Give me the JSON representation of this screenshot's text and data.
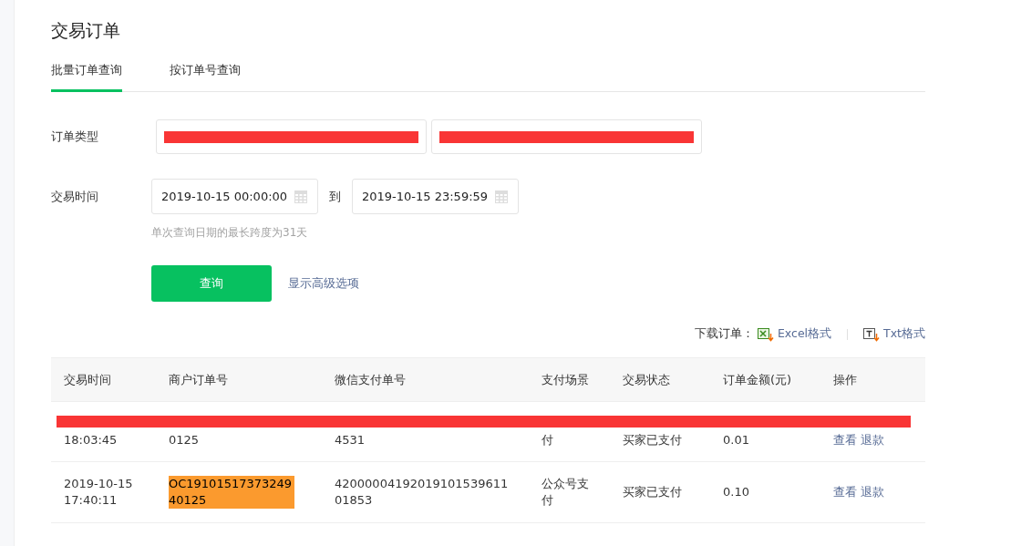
{
  "page_title": "交易订单",
  "tabs": [
    {
      "label": "批量订单查询",
      "selected": true
    },
    {
      "label": "按订单号查询",
      "selected": false
    }
  ],
  "form": {
    "order_type_label": "订单类型",
    "time_label": "交易时间",
    "start_time": "2019-10-15 00:00:00",
    "to_label": "到",
    "end_time": "2019-10-15 23:59:59",
    "hint": "单次查询日期的最长跨度为31天",
    "query_button": "查询",
    "advanced_link": "显示高级选项"
  },
  "download": {
    "label": "下载订单：",
    "excel": "Excel格式",
    "txt": "Txt格式"
  },
  "table": {
    "columns": [
      "交易时间",
      "商户订单号",
      "微信支付单号",
      "支付场景",
      "交易状态",
      "订单金额(元)",
      "操作"
    ],
    "rows": [
      {
        "time": "18:03:45",
        "merchant_no": "0125",
        "wechat_no": "4531",
        "scene": "付",
        "status": "买家已支付",
        "amount": "0.01",
        "actions": [
          "查看",
          "退款"
        ],
        "highlighted": false,
        "clipped": true
      },
      {
        "time": "2019-10-15 17:40:11",
        "merchant_no": "OC1910151737324940125",
        "wechat_no": "4200000419201910153961101853",
        "scene": "公众号支付",
        "status": "买家已支付",
        "amount": "0.10",
        "actions": [
          "查看",
          "退款"
        ],
        "highlighted": true,
        "clipped": false
      }
    ]
  }
}
